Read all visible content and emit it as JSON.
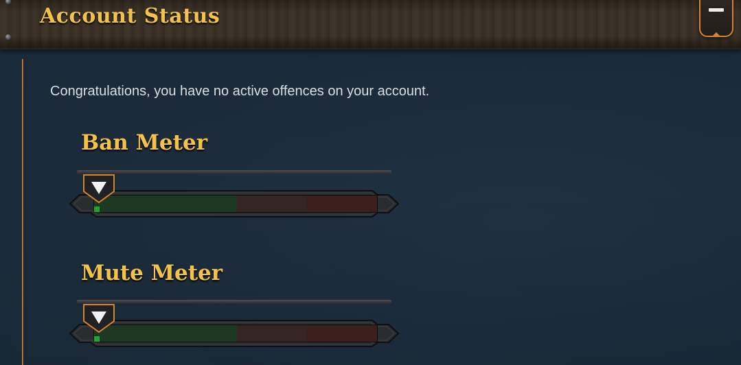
{
  "header": {
    "title": "Account Status",
    "collapse_button": "minus-icon"
  },
  "message": "Congratulations, you have no active offences on your account.",
  "meters": [
    {
      "title": "Ban Meter",
      "level": 0.0
    },
    {
      "title": "Mute Meter",
      "level": 0.0
    }
  ],
  "colors": {
    "title_gold": "#f4c24a",
    "accent_orange": "#d7842f",
    "background": "#1b2b39",
    "meter_fill_green": "#1ea72a"
  }
}
